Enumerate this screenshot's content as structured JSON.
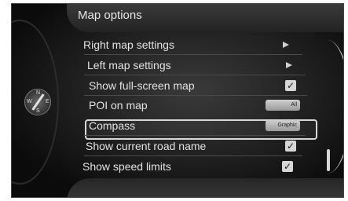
{
  "window": {
    "title": "Map options"
  },
  "menu": {
    "items": [
      {
        "label": "Right map settings",
        "control": "arrow"
      },
      {
        "label": "Left map settings",
        "control": "arrow"
      },
      {
        "label": "Show full-screen map",
        "control": "checkbox",
        "checked": true
      },
      {
        "label": "POI on map",
        "control": "option",
        "value": "All",
        "selected": true
      },
      {
        "label": "Compass",
        "control": "option",
        "value": "Graphic"
      },
      {
        "label": "Show current road name",
        "control": "checkbox",
        "checked": true
      },
      {
        "label": "Show speed limits",
        "control": "checkbox",
        "checked": true
      }
    ]
  },
  "compass": {
    "n": "N",
    "s": "S",
    "e": "E",
    "w": "W"
  },
  "icons": {
    "check": "✓"
  },
  "colors": {
    "background": "#0f0f0f",
    "text": "#e2e2e2",
    "highlight": "#d8d8d8"
  }
}
